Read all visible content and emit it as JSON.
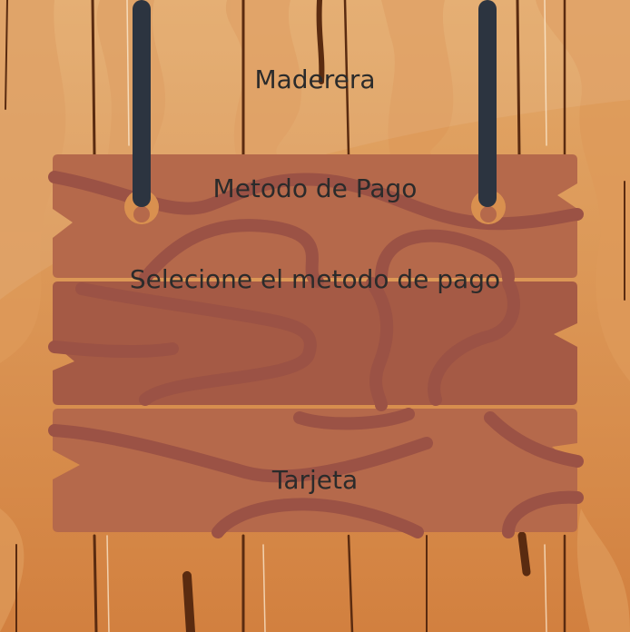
{
  "app": {
    "title": "Maderera"
  },
  "screen": {
    "title": "Metodo de Pago",
    "instruction": "Selecione el metodo de pago"
  },
  "payment_options": [
    {
      "label": "Tarjeta"
    }
  ],
  "colors": {
    "wood_background_light": "#e3a969",
    "wood_background_dark": "#d2803f",
    "wood_grain_dark": "#5a2b10",
    "sign_board": "#b5694b",
    "sign_board_grain": "#9b5245",
    "rope": "#2c3440",
    "text": "#2b2b2b"
  }
}
